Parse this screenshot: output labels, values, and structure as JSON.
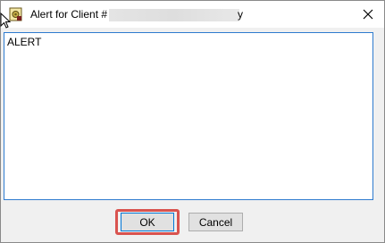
{
  "window": {
    "title_prefix": "Alert for Client #",
    "title_suffix": "y",
    "app_icon": "gear-document-icon",
    "close_icon": "close-icon"
  },
  "message": {
    "text": "ALERT"
  },
  "buttons": {
    "ok_label": "OK",
    "cancel_label": "Cancel"
  },
  "colors": {
    "focus_border": "#0078d7",
    "highlight": "#d9534f",
    "textbox_border": "#2e7bcf"
  }
}
